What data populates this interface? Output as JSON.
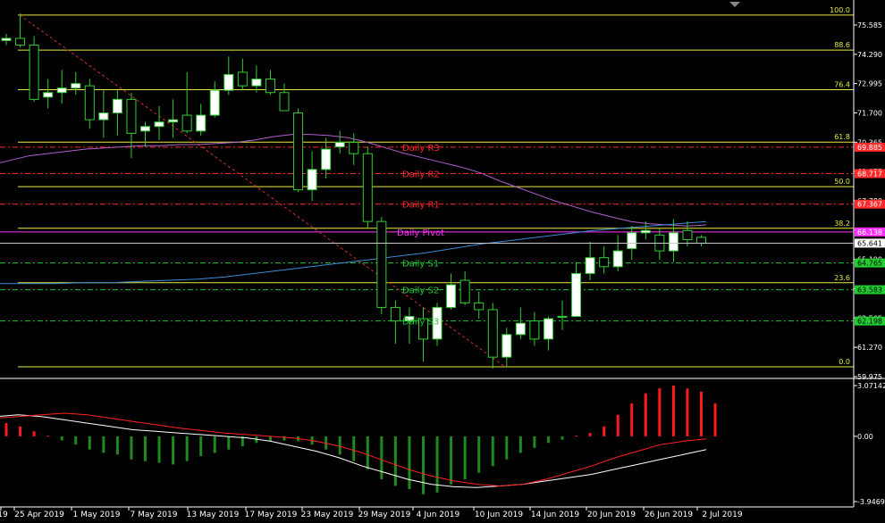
{
  "colors": {
    "background": "#000000",
    "fib": "#e8e840",
    "bull_candle": "#ffffff",
    "bear_candle": "#000000",
    "wick": "#33cc33",
    "ma_purple": "#b060d0",
    "ma_blue": "#3a8ad8",
    "resistance": "#ff2a2a",
    "support": "#22cc33",
    "pivot": "#ff33ff",
    "macd_line": "#ffffff",
    "signal_line": "#ff2222",
    "hist_pos": "#ff1a1a",
    "hist_neg": "#1e8a1e",
    "current_price_bg": "#ffffff"
  },
  "price_axis": {
    "min": 59.975,
    "max": 76.0,
    "ticks": [
      "75.585",
      "74.290",
      "72.995",
      "71.700",
      "70.365",
      "69.075",
      "67.780",
      "66.485",
      "65.190",
      "63.860",
      "62.565",
      "61.270",
      "59.975"
    ]
  },
  "fib_levels": [
    {
      "label": "100.0",
      "value": 75.73
    },
    {
      "label": "88.6",
      "value": 74.18
    },
    {
      "label": "76.4",
      "value": 72.43
    },
    {
      "label": "61.8",
      "value": 70.11
    },
    {
      "label": "50.0",
      "value": 68.14
    },
    {
      "label": "38.2",
      "value": 66.3
    },
    {
      "label": "23.6",
      "value": 63.89
    },
    {
      "label": "0.0",
      "value": 60.17
    }
  ],
  "pivots": [
    {
      "label": "Daily R3",
      "value": 69.885,
      "tag": "69.885",
      "kind": "res"
    },
    {
      "label": "Daily R2",
      "value": 68.717,
      "tag": "68.717",
      "kind": "res"
    },
    {
      "label": "Daily R1",
      "value": 67.367,
      "tag": "67.367",
      "kind": "res"
    },
    {
      "label": "Daily Pivot",
      "value": 66.138,
      "tag": "66.138",
      "kind": "pivot"
    },
    {
      "label": "Daily S1",
      "value": 64.765,
      "tag": "64.765",
      "kind": "sup"
    },
    {
      "label": "Daily S2",
      "value": 63.583,
      "tag": "63.583",
      "kind": "sup"
    },
    {
      "label": "Daily S3",
      "value": 62.198,
      "tag": "62.198",
      "kind": "sup"
    }
  ],
  "current_price": {
    "value": 65.641,
    "label": "65.641"
  },
  "macd_axis": {
    "max_label": "3.07142",
    "zero_label": "0.00",
    "min_label": "-3.94698",
    "max": 3.07142,
    "min": -3.94698
  },
  "date_labels": [
    "19",
    "25 Apr 2019",
    "1 May 2019",
    "7 May 2019",
    "13 May 2019",
    "17 May 2019",
    "23 May 2019",
    "29 May 2019",
    "4 Jun 2019",
    "10 Jun 2019",
    "14 Jun 2019",
    "20 Jun 2019",
    "26 Jun 2019",
    "2 Jul 2019"
  ],
  "chart_data": {
    "type": "candlestick",
    "candles": [
      [
        74.6,
        74.9,
        74.4,
        74.7
      ],
      [
        74.7,
        75.8,
        74.3,
        74.4
      ],
      [
        74.4,
        74.8,
        71.9,
        72.0
      ],
      [
        72.1,
        72.9,
        71.6,
        72.3
      ],
      [
        72.3,
        73.3,
        71.8,
        72.5
      ],
      [
        72.5,
        73.2,
        72.2,
        72.7
      ],
      [
        72.6,
        72.9,
        70.7,
        71.1
      ],
      [
        71.1,
        72.4,
        70.3,
        71.4
      ],
      [
        71.4,
        72.4,
        70.4,
        72.0
      ],
      [
        72.0,
        72.3,
        69.4,
        70.5
      ],
      [
        70.6,
        71.0,
        69.9,
        70.8
      ],
      [
        70.8,
        71.7,
        70.2,
        71.0
      ],
      [
        71.0,
        72.0,
        70.3,
        71.1
      ],
      [
        71.3,
        73.2,
        70.5,
        70.6
      ],
      [
        70.6,
        71.8,
        70.4,
        71.3
      ],
      [
        71.3,
        72.8,
        71.2,
        72.4
      ],
      [
        72.4,
        73.9,
        72.2,
        73.1
      ],
      [
        73.2,
        73.8,
        72.4,
        72.6
      ],
      [
        72.6,
        73.5,
        72.3,
        72.9
      ],
      [
        72.9,
        73.3,
        72.2,
        72.3
      ],
      [
        72.3,
        72.7,
        71.5,
        71.5
      ],
      [
        71.4,
        71.6,
        67.9,
        68.0
      ],
      [
        68.0,
        69.7,
        67.5,
        68.9
      ],
      [
        68.9,
        70.3,
        68.5,
        69.8
      ],
      [
        69.9,
        70.6,
        69.6,
        70.1
      ],
      [
        70.1,
        70.5,
        69.1,
        69.6
      ],
      [
        69.6,
        69.9,
        66.3,
        66.6
      ],
      [
        66.6,
        66.8,
        62.5,
        62.8
      ],
      [
        62.8,
        63.1,
        61.2,
        62.2
      ],
      [
        62.2,
        62.8,
        61.2,
        62.4
      ],
      [
        62.3,
        62.8,
        60.4,
        61.4
      ],
      [
        61.4,
        63.0,
        61.1,
        62.8
      ],
      [
        62.8,
        64.3,
        62.7,
        63.8
      ],
      [
        64.0,
        64.4,
        62.9,
        63.0
      ],
      [
        63.0,
        63.5,
        62.3,
        62.7
      ],
      [
        62.7,
        63.0,
        60.1,
        60.6
      ],
      [
        60.6,
        61.9,
        60.2,
        61.6
      ],
      [
        61.6,
        62.8,
        61.4,
        62.1
      ],
      [
        62.2,
        62.6,
        61.1,
        61.4
      ],
      [
        61.4,
        62.4,
        60.9,
        62.3
      ],
      [
        62.4,
        63.1,
        61.8,
        62.4
      ],
      [
        62.4,
        64.8,
        62.4,
        64.3
      ],
      [
        64.3,
        65.7,
        64.0,
        65.0
      ],
      [
        65.0,
        65.5,
        64.3,
        64.6
      ],
      [
        64.6,
        66.0,
        64.4,
        65.3
      ],
      [
        65.4,
        66.4,
        64.9,
        66.1
      ],
      [
        66.1,
        66.6,
        65.8,
        66.2
      ],
      [
        66.0,
        66.3,
        64.9,
        65.3
      ],
      [
        65.3,
        66.7,
        64.8,
        66.1
      ],
      [
        66.2,
        66.6,
        65.5,
        65.8
      ],
      [
        65.9,
        66.0,
        65.5,
        65.64
      ]
    ],
    "ma_purple": [
      69.1,
      69.3,
      69.5,
      69.6,
      69.7,
      69.8,
      69.85,
      69.9,
      69.95,
      69.95,
      70.0,
      70.0,
      70.05,
      70.1,
      70.2,
      70.35,
      70.45,
      70.45,
      70.4,
      70.3,
      70.1,
      69.85,
      69.6,
      69.4,
      69.2,
      69.0,
      68.75,
      68.4,
      68.1,
      67.8,
      67.5,
      67.25,
      67.0,
      66.8,
      66.6,
      66.5,
      66.45,
      66.4,
      66.45
    ],
    "ma_blue": [
      63.85,
      63.85,
      63.85,
      63.9,
      63.9,
      63.95,
      64.0,
      64.05,
      64.15,
      64.3,
      64.45,
      64.6,
      64.75,
      64.9,
      65.05,
      65.2,
      65.4,
      65.6,
      65.75,
      65.9,
      66.05,
      66.2,
      66.3,
      66.4,
      66.5,
      66.6
    ],
    "macd_hist": [
      0.8,
      0.6,
      0.3,
      0.05,
      -0.25,
      -0.5,
      -0.8,
      -1.0,
      -1.1,
      -1.4,
      -1.5,
      -1.6,
      -1.7,
      -1.5,
      -1.2,
      -1.0,
      -0.8,
      -0.6,
      -0.4,
      -0.3,
      -0.25,
      -0.3,
      -0.5,
      -0.8,
      -1.1,
      -1.5,
      -2.0,
      -2.6,
      -3.0,
      -3.2,
      -3.5,
      -3.4,
      -2.9,
      -2.6,
      -2.2,
      -1.8,
      -1.4,
      -1.0,
      -0.7,
      -0.4,
      -0.2,
      0.05,
      0.2,
      0.6,
      1.3,
      2.0,
      2.6,
      2.9,
      3.07,
      2.9,
      2.7,
      2.0
    ],
    "macd_line": [
      1.2,
      1.3,
      1.2,
      1.0,
      0.8,
      0.6,
      0.4,
      0.3,
      0.2,
      0.1,
      0.0,
      -0.1,
      -0.3,
      -0.6,
      -0.9,
      -1.3,
      -1.8,
      -2.2,
      -2.6,
      -2.9,
      -3.05,
      -3.1,
      -3.0,
      -2.9,
      -2.7,
      -2.5,
      -2.3,
      -2.0,
      -1.7,
      -1.4,
      -1.1,
      -0.8
    ],
    "signal_line": [
      1.1,
      1.2,
      1.3,
      1.4,
      1.3,
      1.1,
      0.9,
      0.7,
      0.5,
      0.35,
      0.2,
      0.1,
      0.0,
      -0.1,
      -0.3,
      -0.6,
      -1.0,
      -1.5,
      -2.0,
      -2.4,
      -2.7,
      -2.9,
      -3.0,
      -2.9,
      -2.6,
      -2.2,
      -1.8,
      -1.3,
      -0.9,
      -0.5,
      -0.3,
      -0.15
    ]
  }
}
